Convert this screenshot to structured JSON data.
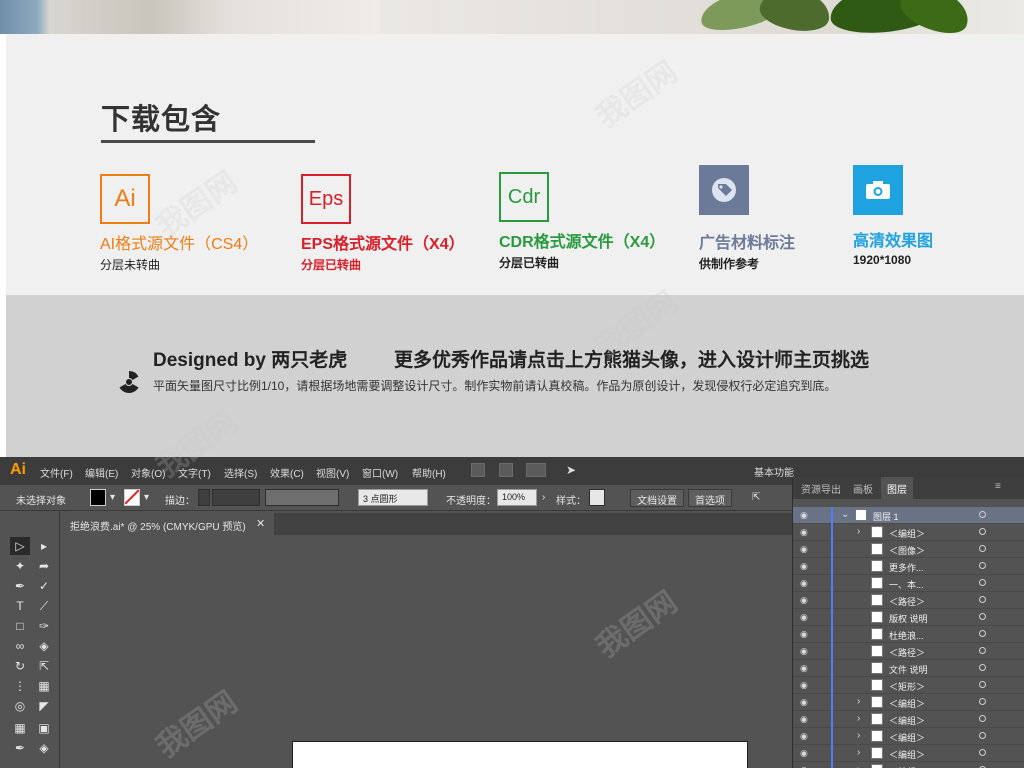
{
  "downloads": {
    "title": "下载包含",
    "items": [
      {
        "icon_text": "Ai",
        "label": "AI格式源文件（CS4）",
        "sub": "分层未转曲",
        "color": "#f07c14"
      },
      {
        "icon_text": "Eps",
        "label": "EPS格式源文件（X4）",
        "sub": "分层已转曲",
        "color": "#d8202a"
      },
      {
        "icon_text": "Cdr",
        "label": "CDR格式源文件（X4）",
        "sub": "分层已转曲",
        "color": "#2a9a3e"
      },
      {
        "icon_text": "",
        "label": "广告材料标注",
        "sub": "供制作参考",
        "color": "#6b7a99",
        "icon": "tag-icon"
      },
      {
        "icon_text": "",
        "label": "高清效果图",
        "sub": "1920*1080",
        "color": "#1ea3e0",
        "icon": "camera-icon"
      }
    ]
  },
  "designer": {
    "line": "Designed by 两只老虎",
    "promo": "更多优秀作品请点击上方熊猫头像，进入设计师主页挑选",
    "notice": "平面矢量图尺寸比例1/10，请根据场地需要调整设计尺寸。制作实物前请认真校稿。作品为原创设计，发现侵权行必定追究到底。"
  },
  "app": {
    "logo": "Ai",
    "menu": [
      "文件(F)",
      "编辑(E)",
      "对象(O)",
      "文字(T)",
      "选择(S)",
      "效果(C)",
      "视图(V)",
      "窗口(W)",
      "帮助(H)"
    ],
    "workspace": "基本功能",
    "control": {
      "selection": "未选择对象",
      "stroke_label": "描边：",
      "brush_value": "3 点圆形",
      "opacity_label": "不透明度：",
      "opacity_value": "100%",
      "style_label": "样式：",
      "doc_setup": "文档设置",
      "prefs": "首选项"
    },
    "document_tab": "拒绝浪费.ai* @ 25% (CMYK/GPU 预览)",
    "panel_tabs": [
      "资源导出",
      "画板",
      "图层"
    ],
    "layers": [
      {
        "name": "图层 1",
        "level": 0,
        "expanded": true
      },
      {
        "name": "＜编组＞",
        "level": 1,
        "expandable": true
      },
      {
        "name": "＜图像＞",
        "level": 1
      },
      {
        "name": "更多作...",
        "level": 1
      },
      {
        "name": "一、本...",
        "level": 1
      },
      {
        "name": "＜路径＞",
        "level": 1
      },
      {
        "name": "版权 说明",
        "level": 1
      },
      {
        "name": "杜绝浪...",
        "level": 1
      },
      {
        "name": "＜路径＞",
        "level": 1
      },
      {
        "name": "文件 说明",
        "level": 1
      },
      {
        "name": "＜矩形＞",
        "level": 1
      },
      {
        "name": "＜编组＞",
        "level": 1,
        "expandable": true
      },
      {
        "name": "＜编组＞",
        "level": 1,
        "expandable": true
      },
      {
        "name": "＜编组＞",
        "level": 1,
        "expandable": true
      },
      {
        "name": "＜编组＞",
        "level": 1,
        "expandable": true
      },
      {
        "name": "＜编组＞",
        "level": 1,
        "expandable": true
      }
    ]
  },
  "watermark": "我图网"
}
